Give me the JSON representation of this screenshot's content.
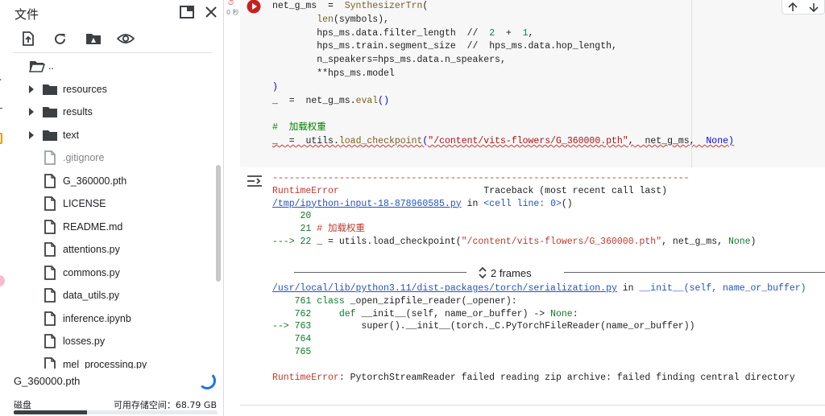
{
  "files_panel": {
    "title": "文件",
    "tree": [
      {
        "name": "..",
        "type": "folder-open",
        "expandable": false
      },
      {
        "name": "resources",
        "type": "folder",
        "expandable": true
      },
      {
        "name": "results",
        "type": "folder",
        "expandable": true
      },
      {
        "name": "text",
        "type": "folder",
        "expandable": true
      },
      {
        "name": ".gitignore",
        "type": "file-muted",
        "expandable": false
      },
      {
        "name": "G_360000.pth",
        "type": "file",
        "expandable": false
      },
      {
        "name": "LICENSE",
        "type": "file",
        "expandable": false
      },
      {
        "name": "README.md",
        "type": "file",
        "expandable": false
      },
      {
        "name": "attentions.py",
        "type": "file",
        "expandable": false
      },
      {
        "name": "commons.py",
        "type": "file",
        "expandable": false
      },
      {
        "name": "data_utils.py",
        "type": "file",
        "expandable": false
      },
      {
        "name": "inference.ipynb",
        "type": "file",
        "expandable": false
      },
      {
        "name": "losses.py",
        "type": "file",
        "expandable": false
      },
      {
        "name": "mel_processing.py",
        "type": "file",
        "expandable": false
      }
    ],
    "path_input_value": "G_360000.pth",
    "disk_label": "磁盘",
    "disk_free": "可用存储空间：68.79 GB",
    "disk_used_fraction": 0.36
  },
  "cell": {
    "exec_status_time": "0 秒",
    "code": {
      "l1_var": "net_g_ms",
      "l1_eq": "=",
      "l1_fn": "SynthesizerTrn",
      "l1_paren": "(",
      "l2_fn": "len",
      "l2_arg": "(symbols),",
      "l3_a": "hps_ms.data.filter_length",
      "l3_op": "//",
      "l3_n1": "2",
      "l3_plus": "+",
      "l3_n2": "1",
      "l3_comma": ",",
      "l4_a": "hps_ms.train.segment_size",
      "l4_op": "//",
      "l4_b": "hps_ms.data.hop_length,",
      "l5": "n_speakers=hps_ms.data.n_speakers,",
      "l6": "**hps_ms.model",
      "l7": ")",
      "l8_var": "_",
      "l8_eq": "=",
      "l8_obj": "net_g_ms.",
      "l8_fn": "eval",
      "l8_paren": "()",
      "l9_comment": "#  加载权重",
      "l10_var": "_",
      "l10_eq": "=",
      "l10_obj": "utils.",
      "l10_fn": "load_checkpoint",
      "l10_open": "(",
      "l10_str": "\"/content/vits-flowers/G_360000.pth\"",
      "l10_comma": ",",
      "l10_arg": "net_g_ms,",
      "l10_none": "None",
      "l10_close": ")"
    }
  },
  "output": {
    "dashes": "---------------------------------------------------------------------------",
    "error_name": "RuntimeError",
    "traceback_label": "Traceback (most recent call last)",
    "tb1_link": "/tmp/ipython-input-18-878960585.py",
    "tb1_in": "in",
    "tb1_cell": "<cell line: 0>",
    "tb1_cell_paren": "()",
    "tb1_l20": "     20",
    "tb1_l21_num": "     21",
    "tb1_l21_text": "# 加载权重",
    "tb1_l22_arrow": "---> 22",
    "tb1_l22_a": "_ = utils.load_checkpoint(",
    "tb1_l22_str": "\"/content/vits-flowers/G_360000.pth\"",
    "tb1_l22_b": ", net_g_ms, ",
    "tb1_l22_none": "None",
    "tb1_l22_c": ")",
    "frames_label": "2 frames",
    "tb2_link": "/usr/local/lib/python3.11/dist-packages/torch/serialization.py",
    "tb2_in": "in",
    "tb2_fn": "__init__",
    "tb2_args": "(self, name_or_buffer)",
    "tb2_l761_num": "    761",
    "tb2_l761_kw": "class",
    "tb2_l761_rest": " _open_zipfile_reader(_opener):",
    "tb2_l762_num": "    762",
    "tb2_l762_kw": "    def",
    "tb2_l762_rest": " __init__(self, name_or_buffer) -> ",
    "tb2_l762_none": "None",
    "tb2_l762_end": ":",
    "tb2_l763_arrow": "--> 763",
    "tb2_l763_rest": "        super().__init__(torch._C.PyTorchFileReader(name_or_buffer))",
    "tb2_l764": "    764",
    "tb2_l765": "    765",
    "final_error_name": "RuntimeError",
    "final_error_msg": ": PytorchStreamReader failed reading zip archive: failed finding central directory"
  },
  "icons": {
    "close": "close-icon",
    "dock": "dock-panel-icon",
    "upload": "upload-icon",
    "refresh": "refresh-icon",
    "drive": "drive-icon",
    "hide": "eye-icon",
    "run": "run-stop-icon",
    "output": "output-toggle-icon"
  },
  "colors": {
    "accent": "#1a73e8",
    "error": "#d93025",
    "run_button": "#c5221f"
  }
}
